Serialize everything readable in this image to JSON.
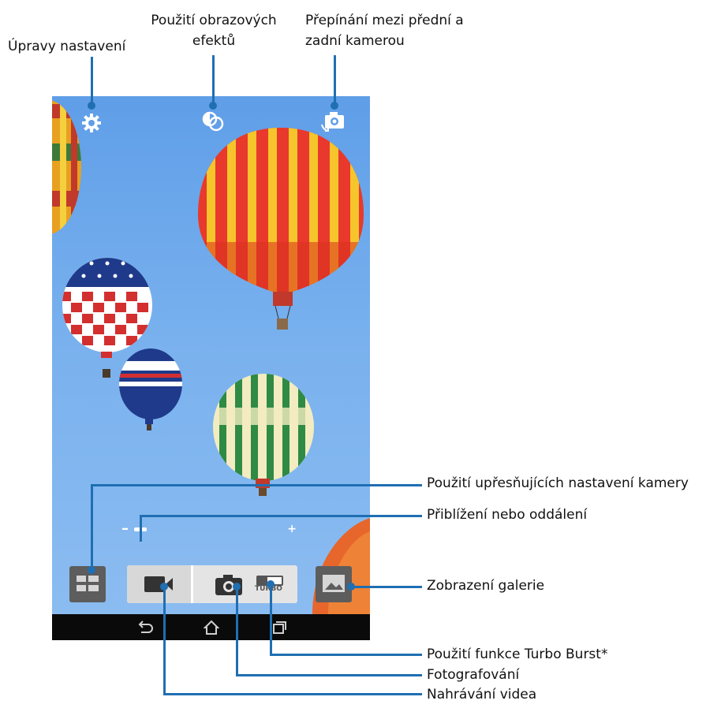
{
  "callouts": {
    "settings": "Úpravy nastavení",
    "effects_line1": "Použití obrazových",
    "effects_line2": "efektů",
    "switch_line1": "Přepínání mezi přední a",
    "switch_line2": "zadní kamerou",
    "advanced": "Použití upřesňujících nastavení kamery",
    "zoom": "Přiblížení nebo oddálení",
    "gallery": "Zobrazení galerie",
    "turbo": "Použití funkce Turbo Burst*",
    "photo": "Fotografování",
    "video": "Nahrávání videa"
  },
  "zoom": {
    "minus": "–",
    "plus": "+",
    "level": 0.0
  },
  "turbo_label": "TURBO",
  "colors": {
    "callout_line": "#1f6fb2",
    "sky": "#79b1ee"
  }
}
